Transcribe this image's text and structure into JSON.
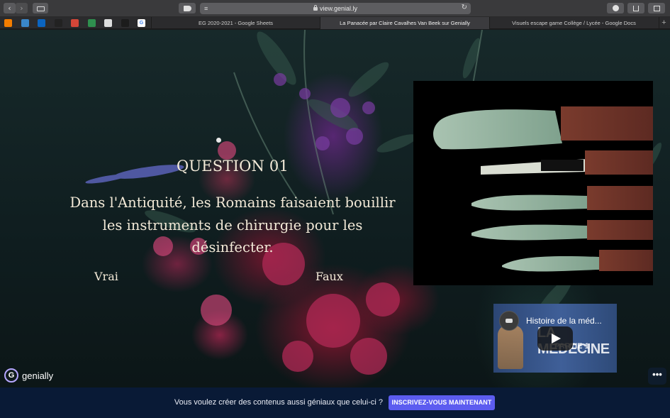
{
  "browser": {
    "url": "view.genial.ly",
    "bookmarks": [
      {
        "icon": "blogger-icon",
        "color": "#f57d00"
      },
      {
        "icon": "twitter-icon",
        "color": "#3a86c8"
      },
      {
        "icon": "outlook-icon",
        "color": "#0b64c0"
      },
      {
        "icon": "pix-icon",
        "color": "#222222"
      },
      {
        "icon": "gmail-icon",
        "color": "#d44638"
      },
      {
        "icon": "google-drive-icon",
        "color": "#2f8f4e"
      },
      {
        "icon": "bookmark-icon",
        "color": "#dddddd"
      },
      {
        "icon": "dark-square-icon",
        "color": "#1c1c1c"
      },
      {
        "icon": "google-icon",
        "color": "#ffffff"
      }
    ],
    "tabs": [
      {
        "label": "EG 2020-2021 - Google Sheets",
        "active": false
      },
      {
        "label": "La Panacée par Claire Cavalhes Van Beek sur Genially",
        "active": true
      },
      {
        "label": "Visuels escape game Collège / Lycée - Google Docs",
        "active": false
      }
    ],
    "new_tab": "+"
  },
  "slide": {
    "question_title": "QUESTION 01",
    "question_lines": [
      "Dans l'Antiquité, les Romains faisaient bouillir",
      "les instruments de chirurgie pour les",
      "désinfecter."
    ],
    "answers": {
      "true_label": "Vrai",
      "false_label": "Faux"
    },
    "video": {
      "title": "Histoire de la méd...",
      "thumbnail_big_text": "LA MÉDECINE",
      "thumbnail_sub_text": "PARTIE 1"
    }
  },
  "brand": {
    "logo_letter": "G",
    "name": "genially"
  },
  "more_button": "•••",
  "footer": {
    "message": "Vous voulez créer des contenus aussi géniaux que celui-ci ?",
    "cta": "INSCRIVEZ-VOUS MAINTENANT",
    "cta_color": "#5c5cf0",
    "background": "#091a36"
  }
}
